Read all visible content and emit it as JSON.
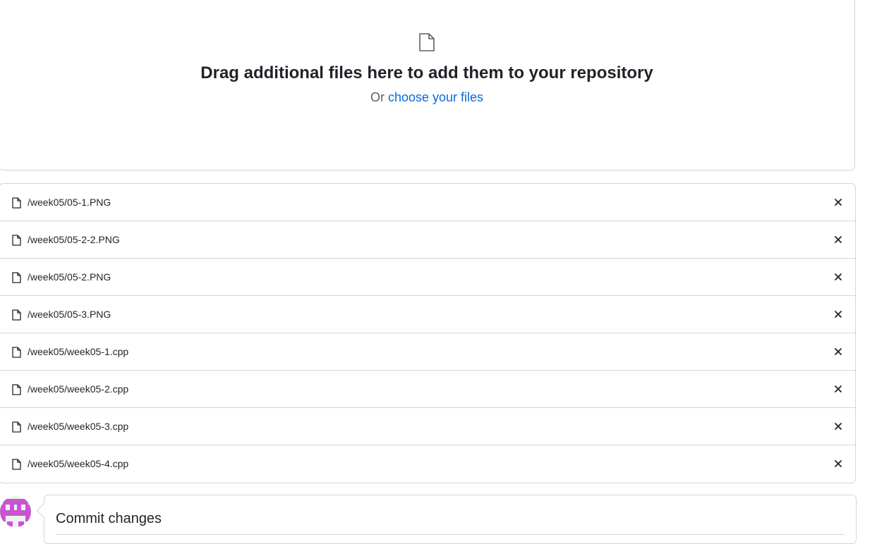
{
  "dropzone": {
    "icon": "file-icon",
    "title": "Drag additional files here to add them to your repository",
    "or_text": "Or ",
    "choose_link": "choose your files"
  },
  "files": [
    {
      "name": "/week05/05-1.PNG"
    },
    {
      "name": "/week05/05-2-2.PNG"
    },
    {
      "name": "/week05/05-2.PNG"
    },
    {
      "name": "/week05/05-3.PNG"
    },
    {
      "name": "/week05/week05-1.cpp"
    },
    {
      "name": "/week05/week05-2.cpp"
    },
    {
      "name": "/week05/week05-3.cpp"
    },
    {
      "name": "/week05/week05-4.cpp"
    }
  ],
  "file_icon": "file-icon",
  "remove_icon": "close-icon",
  "commit": {
    "title": "Commit changes",
    "avatar_color": "#c855cf"
  },
  "colors": {
    "border": "#d0d7de",
    "link": "#0969da",
    "text": "#1f2328",
    "muted": "#57606a"
  }
}
